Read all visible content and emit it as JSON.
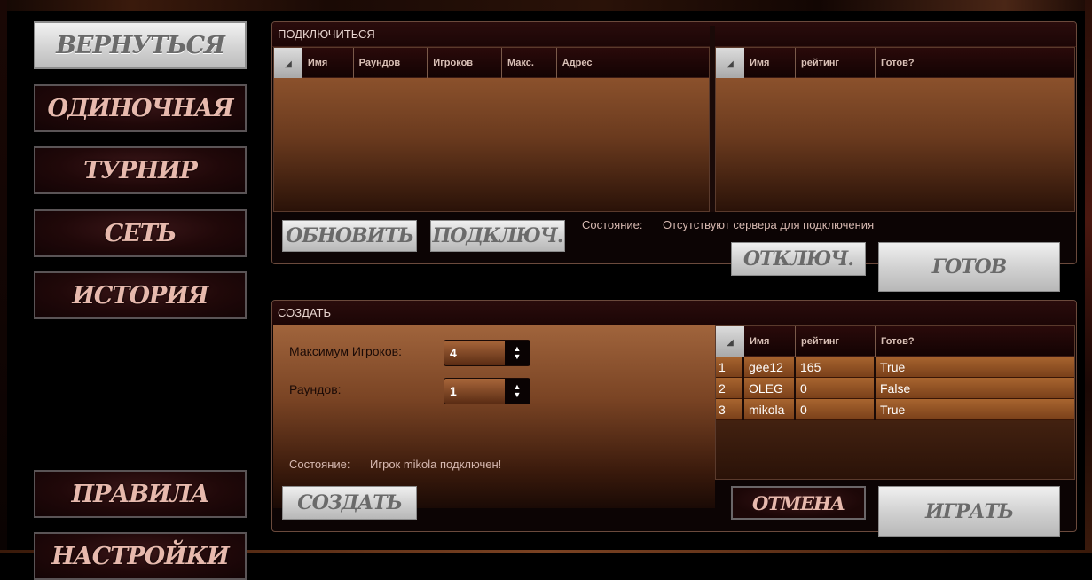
{
  "sidebar": {
    "back": "ВЕРНУТЬСЯ",
    "single": "ОДИНОЧНАЯ",
    "tournament": "ТУРНИР",
    "network": "СЕТЬ",
    "history": "ИСТОРИЯ",
    "rules": "ПРАВИЛА",
    "settings": "НАСТРОЙКИ"
  },
  "connect": {
    "title": "ПОДКЛЮЧИТЬСЯ",
    "servers_columns": [
      "Имя",
      "Раундов",
      "Игроков",
      "Макс.",
      "Адрес"
    ],
    "players_columns": [
      "Имя",
      "рейтинг",
      "Готов?"
    ],
    "refresh_label": "ОБНОВИТЬ",
    "connect_label": "ПОДКЛЮЧ.",
    "status_label": "Состояние:",
    "status_text": "Отсутствуют сервера для подключения",
    "disconnect_label": "ОТКЛЮЧ.",
    "ready_label": "ГОТОВ"
  },
  "create": {
    "title": "СОЗДАТЬ",
    "max_players_label": "Максимум Игроков:",
    "max_players_value": "4",
    "rounds_label": "Раундов:",
    "rounds_value": "1",
    "status_label": "Состояние:",
    "status_text": "Игрок mikola подключен!",
    "create_label": "СОЗДАТЬ",
    "cancel_label": "ОТМЕНА",
    "play_label": "ИГРАТЬ",
    "players_columns": [
      "Имя",
      "рейтинг",
      "Готов?"
    ],
    "players": [
      {
        "num": "1",
        "name": "gee12",
        "rating": "165",
        "ready": "True"
      },
      {
        "num": "2",
        "name": "OLEG",
        "rating": "0",
        "ready": "False"
      },
      {
        "num": "3",
        "name": "mikola",
        "rating": "0",
        "ready": "True"
      }
    ]
  },
  "icons": {
    "sort": "sort-triangle-icon",
    "spinner": "up-down-arrows-icon"
  },
  "colors": {
    "panel_gradient_top": "#9c5d33",
    "button_text_red": "#e7b9ad",
    "button_grey": "#d2d2d2"
  }
}
